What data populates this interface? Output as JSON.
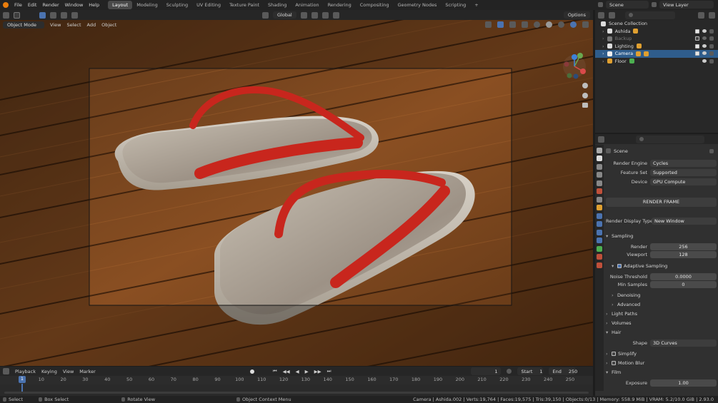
{
  "topbar": {
    "menus": [
      "File",
      "Edit",
      "Render",
      "Window",
      "Help"
    ],
    "workspaces": [
      "Layout",
      "Modeling",
      "Sculpting",
      "UV Editing",
      "Texture Paint",
      "Shading",
      "Animation",
      "Rendering",
      "Compositing",
      "Geometry Nodes",
      "Scripting"
    ],
    "active_workspace": "Layout",
    "scene": "Scene",
    "view_layer": "View Layer"
  },
  "viewport_header": {
    "transform_orientation": "Global",
    "options_label": "Options"
  },
  "viewport_header2": {
    "mode": "Object Mode",
    "menus": [
      "View",
      "Select",
      "Add",
      "Object"
    ]
  },
  "outliner": {
    "collection": "Scene Collection",
    "items": [
      {
        "name": "Ashida",
        "selected": false
      },
      {
        "name": "Backup",
        "selected": false
      },
      {
        "name": "Lighting",
        "selected": false
      },
      {
        "name": "Camera",
        "selected": true
      },
      {
        "name": "Floor",
        "selected": false
      }
    ]
  },
  "properties": {
    "context": "Scene",
    "render_engine_label": "Render Engine",
    "render_engine": "Cycles",
    "feature_set_label": "Feature Set",
    "feature_set": "Supported",
    "device_label": "Device",
    "device": "GPU Compute",
    "render_frame_button": "RENDER FRAME",
    "render_display_label": "Render Display Type",
    "render_display": "New Window",
    "sampling": "Sampling",
    "render_label": "Render",
    "render_samples": "256",
    "viewport_label": "Viewport",
    "viewport_samples": "128",
    "adaptive_sampling": "Adaptive Sampling",
    "noise_threshold_label": "Noise Threshold",
    "noise_threshold": "0.0000",
    "min_samples_label": "Min Samples",
    "min_samples": "0",
    "denoising": "Denoising",
    "advanced": "Advanced",
    "light_paths": "Light Paths",
    "volumes": "Volumes",
    "hair": "Hair",
    "shape_label": "Shape",
    "shape": "3D Curves",
    "simplify": "Simplify",
    "motion_blur": "Motion Blur",
    "film": "Film",
    "exposure_label": "Exposure",
    "exposure": "1.00"
  },
  "timeline": {
    "menus": [
      "Playback",
      "Keying",
      "View",
      "Marker"
    ],
    "current_frame": "1",
    "start_label": "Start",
    "start": "1",
    "end_label": "End",
    "end": "250",
    "ticks": [
      "10",
      "20",
      "30",
      "40",
      "50",
      "60",
      "70",
      "80",
      "90",
      "100",
      "110",
      "120",
      "130",
      "140",
      "150",
      "160",
      "170",
      "180",
      "190",
      "200",
      "210",
      "220",
      "230",
      "240",
      "250"
    ],
    "playhead": "1"
  },
  "status": {
    "select": "Select",
    "box_select": "Box Select",
    "rotate_view": "Rotate View",
    "context_menu": "Object Context Menu",
    "stats": "Camera | Ashida.002 | Verts:19,764 | Faces:19,575 | Tris:39,150 | Objects:0/13 | Memory: 558.9 MiB | VRAM: 5.2/10.0 GiB | 2.93.0"
  },
  "colors": {
    "accent_blue": "#2f5d8c",
    "active_tab": "#4a4a4a",
    "strap_red": "#c8261d",
    "sandal_grey": "#cfc7bb"
  }
}
